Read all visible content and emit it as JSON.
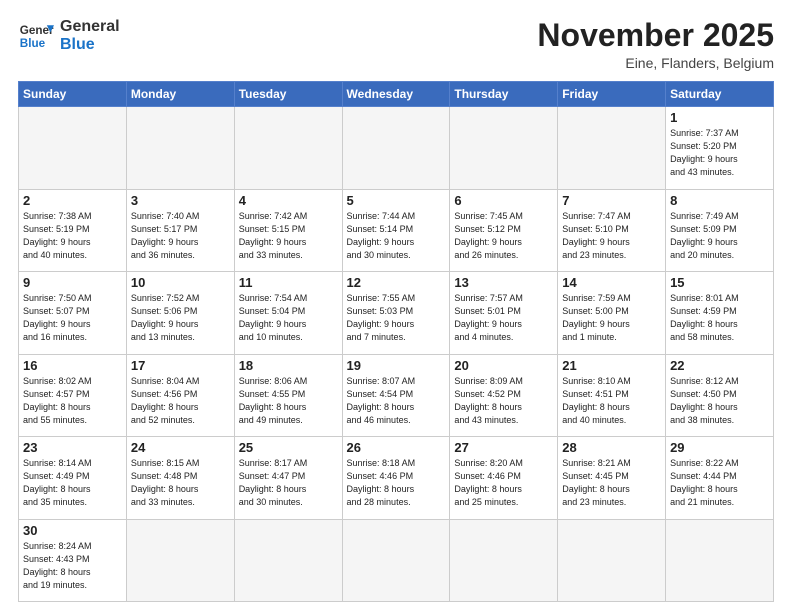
{
  "logo": {
    "general": "General",
    "blue": "Blue"
  },
  "title": "November 2025",
  "location": "Eine, Flanders, Belgium",
  "days_of_week": [
    "Sunday",
    "Monday",
    "Tuesday",
    "Wednesday",
    "Thursday",
    "Friday",
    "Saturday"
  ],
  "weeks": [
    [
      {
        "day": "",
        "info": ""
      },
      {
        "day": "",
        "info": ""
      },
      {
        "day": "",
        "info": ""
      },
      {
        "day": "",
        "info": ""
      },
      {
        "day": "",
        "info": ""
      },
      {
        "day": "",
        "info": ""
      },
      {
        "day": "1",
        "info": "Sunrise: 7:37 AM\nSunset: 5:20 PM\nDaylight: 9 hours\nand 43 minutes."
      }
    ],
    [
      {
        "day": "2",
        "info": "Sunrise: 7:38 AM\nSunset: 5:19 PM\nDaylight: 9 hours\nand 40 minutes."
      },
      {
        "day": "3",
        "info": "Sunrise: 7:40 AM\nSunset: 5:17 PM\nDaylight: 9 hours\nand 36 minutes."
      },
      {
        "day": "4",
        "info": "Sunrise: 7:42 AM\nSunset: 5:15 PM\nDaylight: 9 hours\nand 33 minutes."
      },
      {
        "day": "5",
        "info": "Sunrise: 7:44 AM\nSunset: 5:14 PM\nDaylight: 9 hours\nand 30 minutes."
      },
      {
        "day": "6",
        "info": "Sunrise: 7:45 AM\nSunset: 5:12 PM\nDaylight: 9 hours\nand 26 minutes."
      },
      {
        "day": "7",
        "info": "Sunrise: 7:47 AM\nSunset: 5:10 PM\nDaylight: 9 hours\nand 23 minutes."
      },
      {
        "day": "8",
        "info": "Sunrise: 7:49 AM\nSunset: 5:09 PM\nDaylight: 9 hours\nand 20 minutes."
      }
    ],
    [
      {
        "day": "9",
        "info": "Sunrise: 7:50 AM\nSunset: 5:07 PM\nDaylight: 9 hours\nand 16 minutes."
      },
      {
        "day": "10",
        "info": "Sunrise: 7:52 AM\nSunset: 5:06 PM\nDaylight: 9 hours\nand 13 minutes."
      },
      {
        "day": "11",
        "info": "Sunrise: 7:54 AM\nSunset: 5:04 PM\nDaylight: 9 hours\nand 10 minutes."
      },
      {
        "day": "12",
        "info": "Sunrise: 7:55 AM\nSunset: 5:03 PM\nDaylight: 9 hours\nand 7 minutes."
      },
      {
        "day": "13",
        "info": "Sunrise: 7:57 AM\nSunset: 5:01 PM\nDaylight: 9 hours\nand 4 minutes."
      },
      {
        "day": "14",
        "info": "Sunrise: 7:59 AM\nSunset: 5:00 PM\nDaylight: 9 hours\nand 1 minute."
      },
      {
        "day": "15",
        "info": "Sunrise: 8:01 AM\nSunset: 4:59 PM\nDaylight: 8 hours\nand 58 minutes."
      }
    ],
    [
      {
        "day": "16",
        "info": "Sunrise: 8:02 AM\nSunset: 4:57 PM\nDaylight: 8 hours\nand 55 minutes."
      },
      {
        "day": "17",
        "info": "Sunrise: 8:04 AM\nSunset: 4:56 PM\nDaylight: 8 hours\nand 52 minutes."
      },
      {
        "day": "18",
        "info": "Sunrise: 8:06 AM\nSunset: 4:55 PM\nDaylight: 8 hours\nand 49 minutes."
      },
      {
        "day": "19",
        "info": "Sunrise: 8:07 AM\nSunset: 4:54 PM\nDaylight: 8 hours\nand 46 minutes."
      },
      {
        "day": "20",
        "info": "Sunrise: 8:09 AM\nSunset: 4:52 PM\nDaylight: 8 hours\nand 43 minutes."
      },
      {
        "day": "21",
        "info": "Sunrise: 8:10 AM\nSunset: 4:51 PM\nDaylight: 8 hours\nand 40 minutes."
      },
      {
        "day": "22",
        "info": "Sunrise: 8:12 AM\nSunset: 4:50 PM\nDaylight: 8 hours\nand 38 minutes."
      }
    ],
    [
      {
        "day": "23",
        "info": "Sunrise: 8:14 AM\nSunset: 4:49 PM\nDaylight: 8 hours\nand 35 minutes."
      },
      {
        "day": "24",
        "info": "Sunrise: 8:15 AM\nSunset: 4:48 PM\nDaylight: 8 hours\nand 33 minutes."
      },
      {
        "day": "25",
        "info": "Sunrise: 8:17 AM\nSunset: 4:47 PM\nDaylight: 8 hours\nand 30 minutes."
      },
      {
        "day": "26",
        "info": "Sunrise: 8:18 AM\nSunset: 4:46 PM\nDaylight: 8 hours\nand 28 minutes."
      },
      {
        "day": "27",
        "info": "Sunrise: 8:20 AM\nSunset: 4:46 PM\nDaylight: 8 hours\nand 25 minutes."
      },
      {
        "day": "28",
        "info": "Sunrise: 8:21 AM\nSunset: 4:45 PM\nDaylight: 8 hours\nand 23 minutes."
      },
      {
        "day": "29",
        "info": "Sunrise: 8:22 AM\nSunset: 4:44 PM\nDaylight: 8 hours\nand 21 minutes."
      }
    ],
    [
      {
        "day": "30",
        "info": "Sunrise: 8:24 AM\nSunset: 4:43 PM\nDaylight: 8 hours\nand 19 minutes."
      },
      {
        "day": "",
        "info": ""
      },
      {
        "day": "",
        "info": ""
      },
      {
        "day": "",
        "info": ""
      },
      {
        "day": "",
        "info": ""
      },
      {
        "day": "",
        "info": ""
      },
      {
        "day": "",
        "info": ""
      }
    ]
  ]
}
